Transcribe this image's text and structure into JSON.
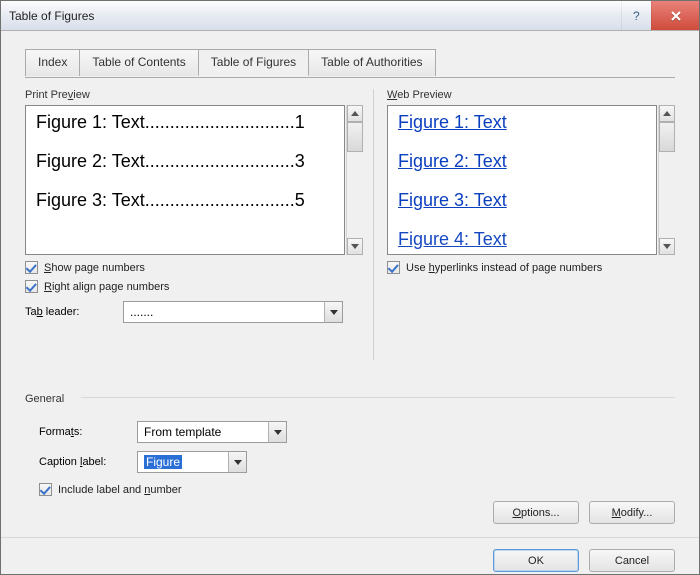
{
  "window": {
    "title": "Table of Figures"
  },
  "tabs": [
    "Index",
    "Table of Contents",
    "Table of Figures",
    "Table of Authorities"
  ],
  "active_tab": 2,
  "print_preview": {
    "label": "Print Preview",
    "entries": [
      {
        "text": "Figure 1: Text",
        "page": "1"
      },
      {
        "text": "Figure 2: Text",
        "page": "3"
      },
      {
        "text": "Figure 3: Text",
        "page": "5"
      }
    ],
    "show_page_numbers": {
      "label_pre": "",
      "label": "Show page numbers",
      "u": "S",
      "checked": true
    },
    "right_align": {
      "label": "Right align page numbers",
      "u": "R",
      "checked": true
    },
    "tab_leader": {
      "label": "Tab leader:",
      "u": "b",
      "value": "......."
    }
  },
  "web_preview": {
    "label": "Web Preview",
    "entries": [
      "Figure 1: Text",
      "Figure 2: Text",
      "Figure 3: Text",
      "Figure 4: Text"
    ],
    "use_hyperlinks": {
      "label": "Use hyperlinks instead of page numbers",
      "u": "h",
      "checked": true
    }
  },
  "general": {
    "label": "General",
    "formats": {
      "label": "Formats:",
      "u": "t",
      "value": "From template"
    },
    "caption_label": {
      "label": "Caption label:",
      "u": "L",
      "value": "Figure"
    },
    "include": {
      "label": "Include label and number",
      "u": "N",
      "checked": true
    }
  },
  "buttons": {
    "options": "Options...",
    "modify": "Modify...",
    "ok": "OK",
    "cancel": "Cancel"
  }
}
